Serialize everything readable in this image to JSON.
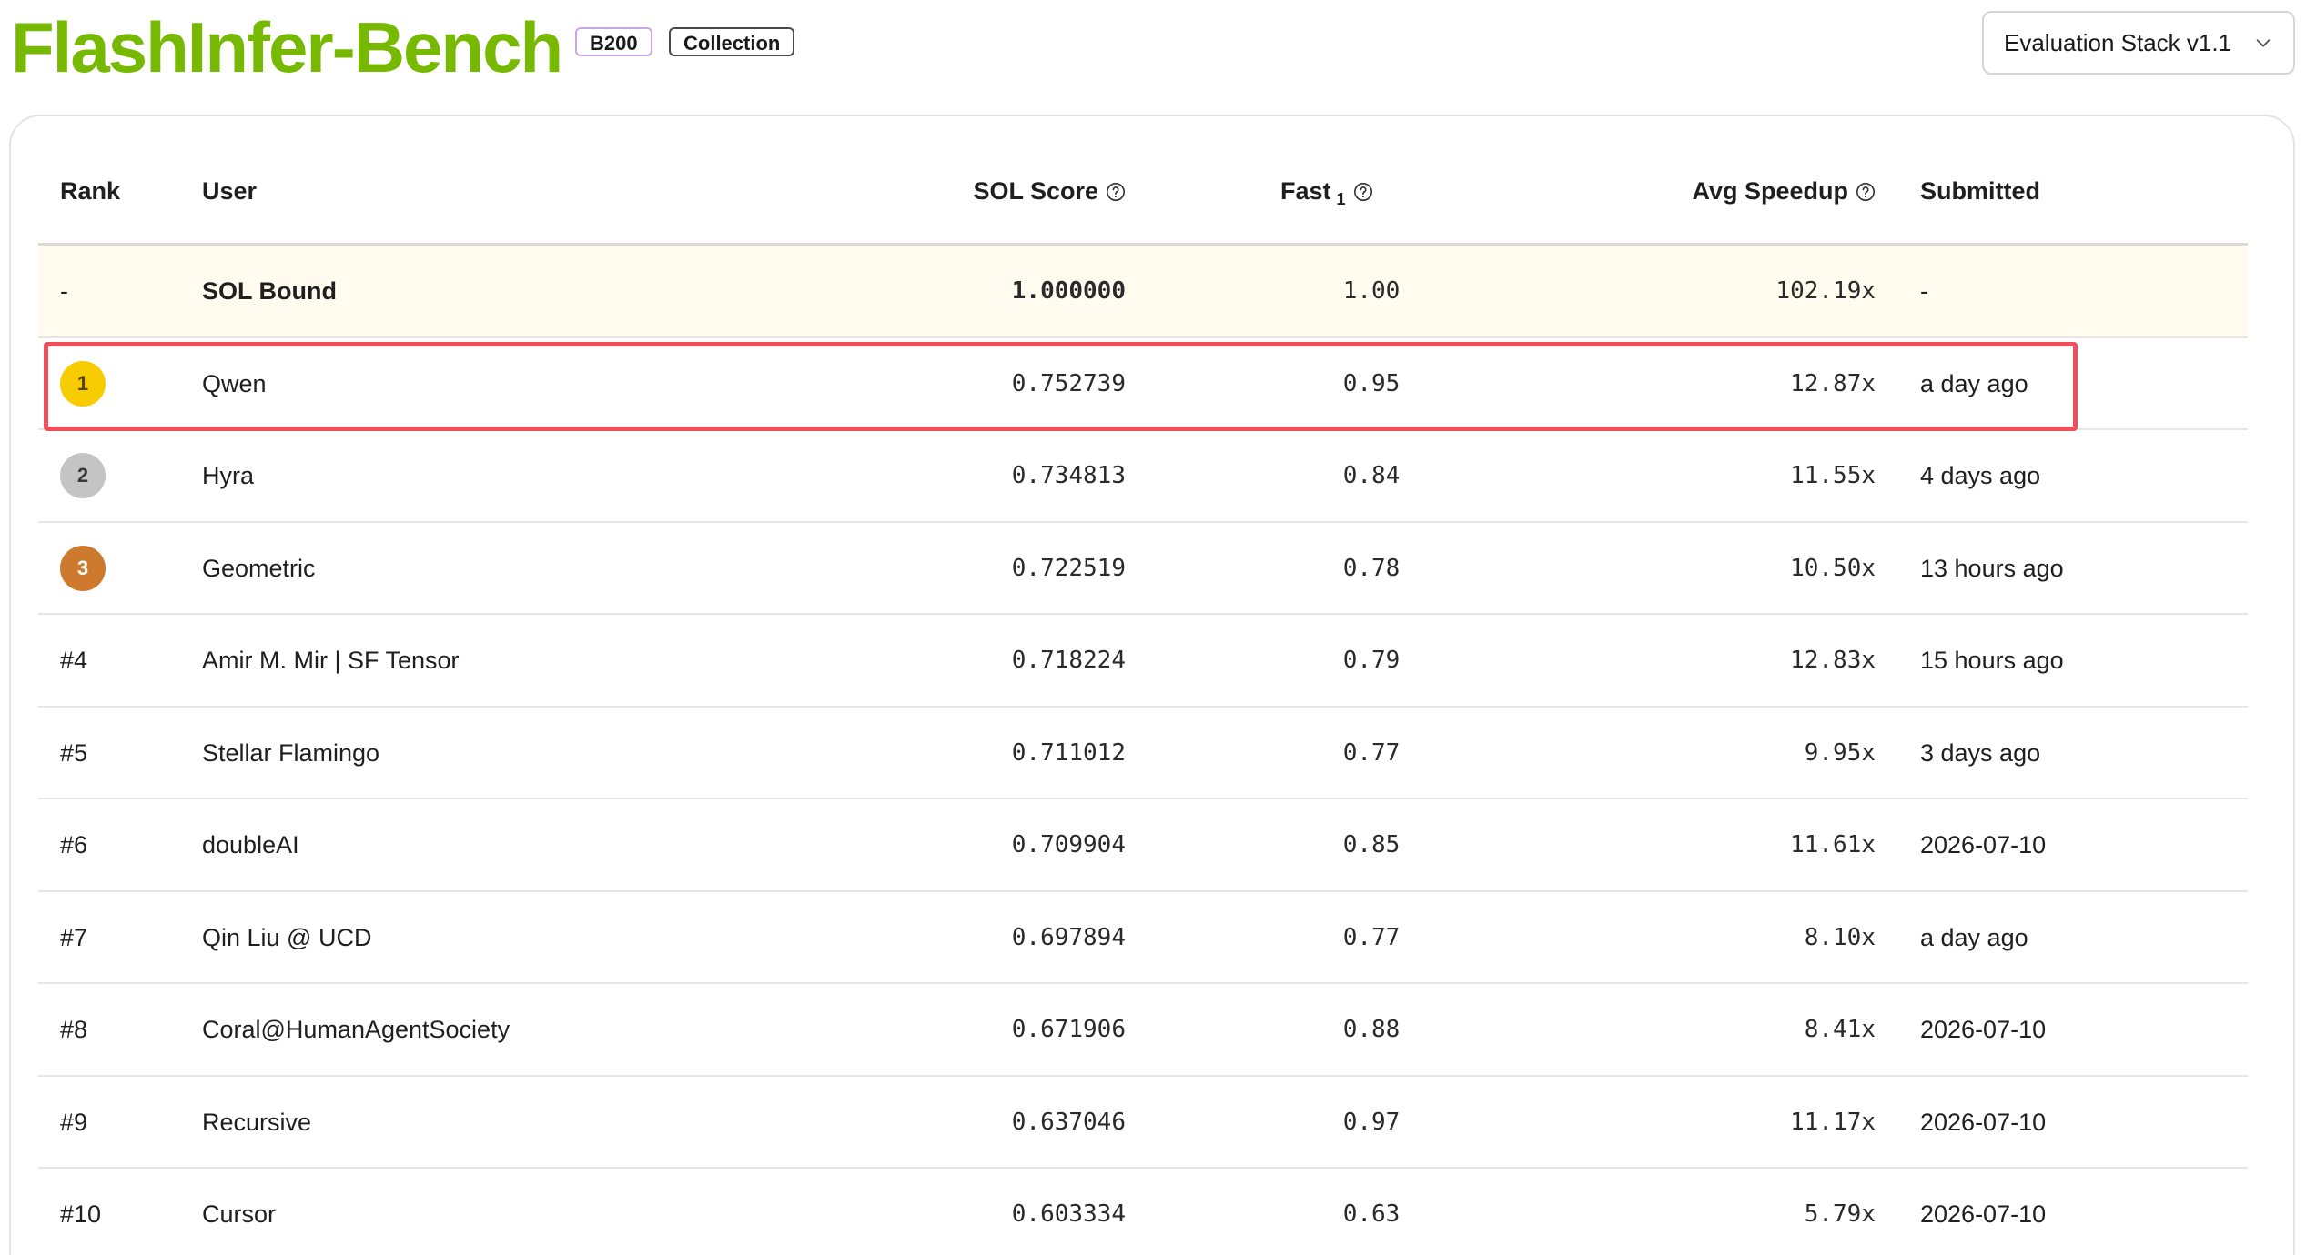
{
  "header": {
    "brand": "FlashInfer-Bench",
    "tags": [
      "B200",
      "Collection"
    ],
    "stack_select": "Evaluation Stack v1.1"
  },
  "table": {
    "columns": {
      "rank": "Rank",
      "user": "User",
      "sol": "SOL Score",
      "fast": "Fast",
      "fast_sub": "1",
      "speedup": "Avg Speedup",
      "submitted": "Submitted"
    },
    "bound": {
      "rank": "-",
      "user": "SOL Bound",
      "sol": "1.000000",
      "fast": "1.00",
      "speedup": "102.19x",
      "submitted": "-"
    },
    "rows": [
      {
        "rank": "1",
        "user": "Qwen",
        "sol": "0.752739",
        "fast": "0.95",
        "speedup": "12.87x",
        "submitted": "a day ago"
      },
      {
        "rank": "2",
        "user": "Hyra",
        "sol": "0.734813",
        "fast": "0.84",
        "speedup": "11.55x",
        "submitted": "4 days ago"
      },
      {
        "rank": "3",
        "user": "Geometric",
        "sol": "0.722519",
        "fast": "0.78",
        "speedup": "10.50x",
        "submitted": "13 hours ago"
      },
      {
        "rank": "#4",
        "user": "Amir M. Mir | SF Tensor",
        "sol": "0.718224",
        "fast": "0.79",
        "speedup": "12.83x",
        "submitted": "15 hours ago"
      },
      {
        "rank": "#5",
        "user": "Stellar Flamingo",
        "sol": "0.711012",
        "fast": "0.77",
        "speedup": "9.95x",
        "submitted": "3 days ago"
      },
      {
        "rank": "#6",
        "user": "doubleAI",
        "sol": "0.709904",
        "fast": "0.85",
        "speedup": "11.61x",
        "submitted": "2026-07-10"
      },
      {
        "rank": "#7",
        "user": "Qin Liu @ UCD",
        "sol": "0.697894",
        "fast": "0.77",
        "speedup": "8.10x",
        "submitted": "a day ago"
      },
      {
        "rank": "#8",
        "user": "Coral@HumanAgentSociety",
        "sol": "0.671906",
        "fast": "0.88",
        "speedup": "8.41x",
        "submitted": "2026-07-10"
      },
      {
        "rank": "#9",
        "user": "Recursive",
        "sol": "0.637046",
        "fast": "0.97",
        "speedup": "11.17x",
        "submitted": "2026-07-10"
      },
      {
        "rank": "#10",
        "user": "Cursor",
        "sol": "0.603334",
        "fast": "0.63",
        "speedup": "5.79x",
        "submitted": "2026-07-10"
      }
    ]
  },
  "colors": {
    "brand": "#76b900",
    "gold": "#f7cc00",
    "silver": "#c4c4c4",
    "bronze": "#cd7a2e",
    "highlight": "#ef4e5a",
    "bound_row_bg": "#fffbee"
  },
  "icons": {
    "help": "question-circle-icon",
    "select": "chevron-down-icon"
  }
}
